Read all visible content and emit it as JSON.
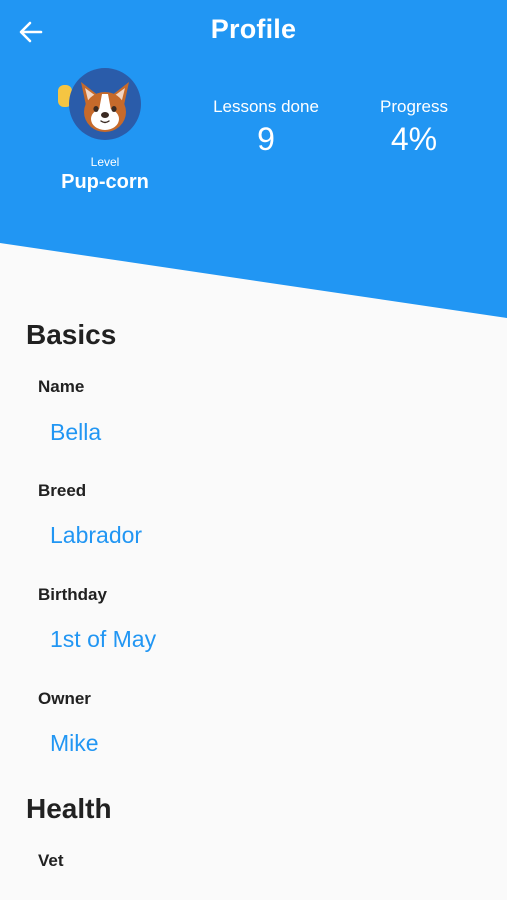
{
  "header": {
    "title": "Profile",
    "back_icon": "arrow-left-icon",
    "bg_color": "#2196f3"
  },
  "profile": {
    "avatar_icon": "corgi-dog-avatar-icon",
    "level_label": "Level",
    "level_name": "Pup-corn"
  },
  "stats": {
    "lessons_label": "Lessons done",
    "lessons_value": "9",
    "progress_label": "Progress",
    "progress_value": "4%"
  },
  "basics": {
    "title": "Basics",
    "fields": [
      {
        "label": "Name",
        "value": "Bella"
      },
      {
        "label": "Breed",
        "value": "Labrador"
      },
      {
        "label": "Birthday",
        "value": "1st of May"
      },
      {
        "label": "Owner",
        "value": "Mike"
      }
    ]
  },
  "health": {
    "title": "Health",
    "fields": [
      {
        "label": "Vet"
      }
    ]
  },
  "colors": {
    "accent": "#2196f3",
    "text_dark": "#212121",
    "background": "#fafafa"
  }
}
